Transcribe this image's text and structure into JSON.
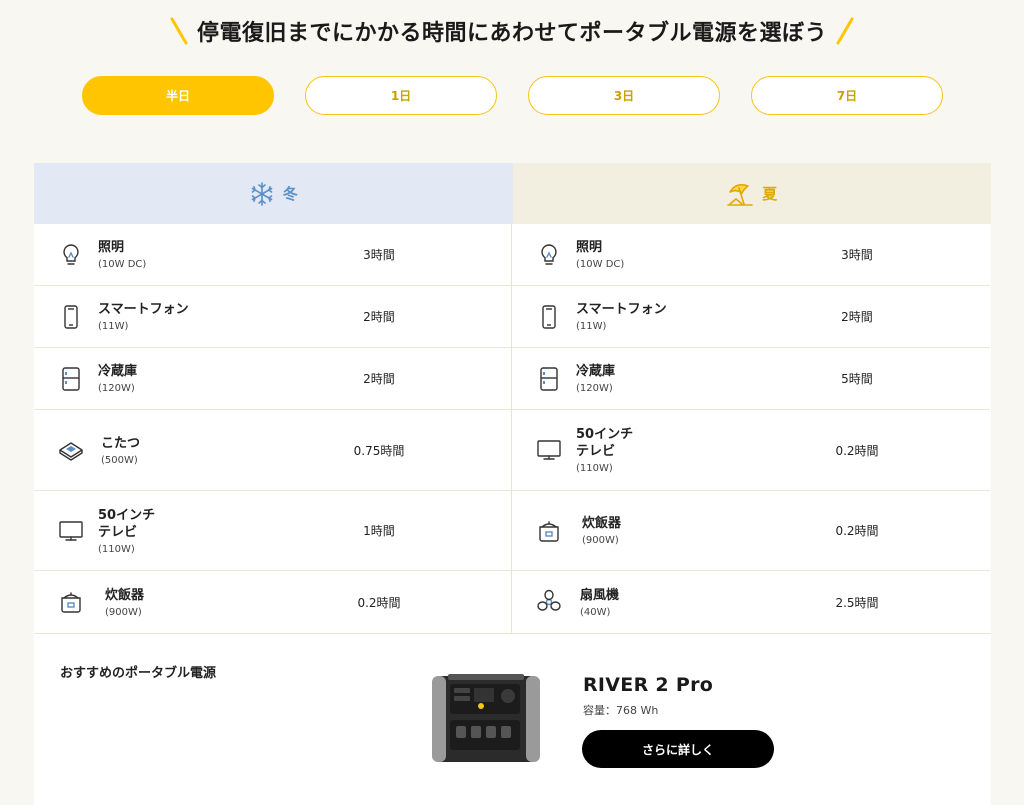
{
  "header": {
    "title": "停電復旧までにかかる時間にあわせてポータブル電源を選ぼう"
  },
  "tabs": [
    {
      "label": "半日",
      "active": true
    },
    {
      "label": "1日",
      "active": false
    },
    {
      "label": "3日",
      "active": false
    },
    {
      "label": "7日",
      "active": false
    }
  ],
  "seasons": {
    "winter": {
      "label": "冬",
      "icon": "snowflake-icon"
    },
    "summer": {
      "label": "夏",
      "icon": "beach-umbrella-icon"
    }
  },
  "winter_items": [
    {
      "name": "照明",
      "watt": "(10W DC)",
      "time": "3時間",
      "icon": "light-bulb-icon"
    },
    {
      "name": "スマートフォン",
      "watt": "(11W)",
      "time": "2時間",
      "icon": "smartphone-icon"
    },
    {
      "name": "冷蔵庫",
      "watt": "(120W)",
      "time": "2時間",
      "icon": "fridge-icon"
    },
    {
      "name": "こたつ",
      "watt": "(500W)",
      "time": "0.75時間",
      "icon": "kotatsu-icon"
    },
    {
      "name_line1": "50インチ",
      "name_line2": "テレビ",
      "watt": "(110W)",
      "time": "1時間",
      "icon": "tv-icon"
    },
    {
      "name": "炊飯器",
      "watt": "(900W)",
      "time": "0.2時間",
      "icon": "rice-cooker-icon"
    }
  ],
  "summer_items": [
    {
      "name": "照明",
      "watt": "(10W DC)",
      "time": "3時間",
      "icon": "light-bulb-icon"
    },
    {
      "name": "スマートフォン",
      "watt": "(11W)",
      "time": "2時間",
      "icon": "smartphone-icon"
    },
    {
      "name": "冷蔵庫",
      "watt": "(120W)",
      "time": "5時間",
      "icon": "fridge-icon"
    },
    {
      "name_line1": "50インチ",
      "name_line2": "テレビ",
      "watt": "(110W)",
      "time": "0.2時間",
      "icon": "tv-icon"
    },
    {
      "name": "炊飯器",
      "watt": "(900W)",
      "time": "0.2時間",
      "icon": "rice-cooker-icon"
    },
    {
      "name": "扇風機",
      "watt": "(40W)",
      "time": "2.5時間",
      "icon": "fan-icon"
    }
  ],
  "recommend": {
    "label": "おすすめのポータブル電源",
    "product_name": "RIVER 2 Pro",
    "capacity": "容量：768 Wh",
    "button": "さらに詳しく"
  },
  "colors": {
    "accent_yellow": "#ffc600",
    "winter_bg": "#e2e8f4",
    "winter_text": "#5a8fc7",
    "summer_bg": "#f3efe0",
    "summer_text": "#e0a800",
    "button_black": "#000000"
  }
}
